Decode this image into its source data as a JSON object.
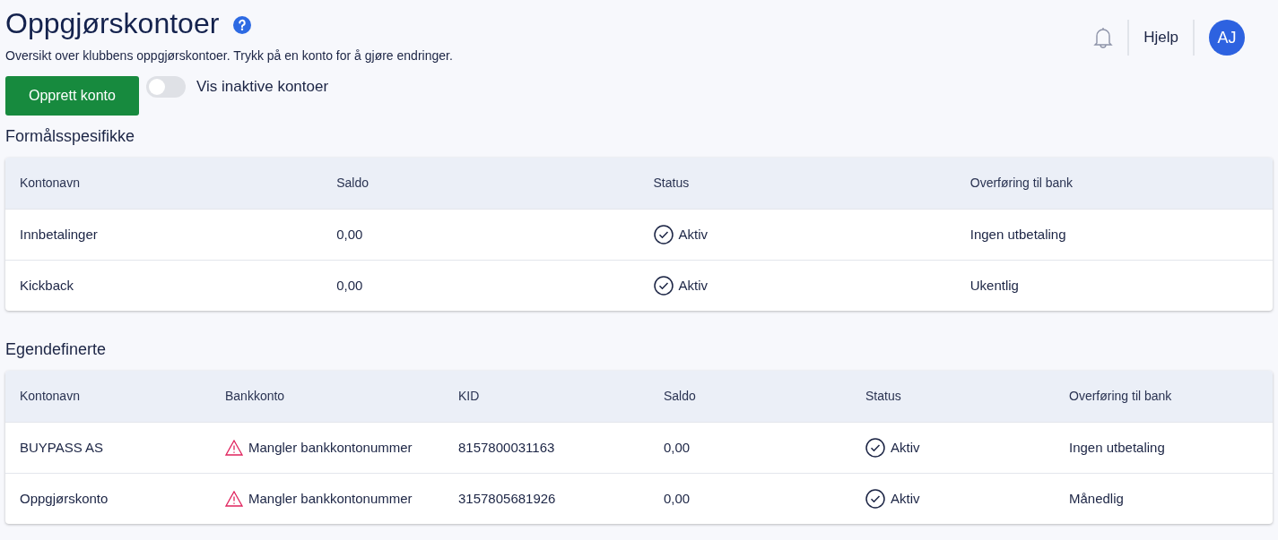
{
  "header": {
    "title": "Oppgjørskontoer",
    "subtitle": "Oversikt over klubbens oppgjørskontoer. Trykk på en konto for å gjøre endringer.",
    "help_link": "Hjelp",
    "avatar": "AJ"
  },
  "actions": {
    "create_button": "Opprett konto",
    "inactive_toggle": {
      "label": "Vis inaktive kontoer",
      "on": false
    }
  },
  "sections": [
    {
      "title": "Formålsspesifikke",
      "columns": [
        "Kontonavn",
        "Saldo",
        "Status",
        "Overføring til bank"
      ],
      "rows": [
        [
          {
            "kind": "text",
            "text": "Innbetalinger"
          },
          {
            "kind": "text",
            "text": "0,00"
          },
          {
            "kind": "status",
            "text": "Aktiv"
          },
          {
            "kind": "text",
            "text": "Ingen utbetaling"
          }
        ],
        [
          {
            "kind": "text",
            "text": "Kickback"
          },
          {
            "kind": "text",
            "text": "0,00"
          },
          {
            "kind": "status",
            "text": "Aktiv"
          },
          {
            "kind": "text",
            "text": "Ukentlig"
          }
        ]
      ]
    },
    {
      "title": "Egendefinerte",
      "columns": [
        "Kontonavn",
        "Bankkonto",
        "KID",
        "Saldo",
        "Status",
        "Overføring til bank"
      ],
      "rows": [
        [
          {
            "kind": "text",
            "text": "BUYPASS AS"
          },
          {
            "kind": "warning",
            "text": "Mangler bankkontonummer"
          },
          {
            "kind": "text",
            "text": "8157800031163"
          },
          {
            "kind": "text",
            "text": "0,00"
          },
          {
            "kind": "status",
            "text": "Aktiv"
          },
          {
            "kind": "text",
            "text": "Ingen utbetaling"
          }
        ],
        [
          {
            "kind": "text",
            "text": "Oppgjørskonto"
          },
          {
            "kind": "warning",
            "text": "Mangler bankkontonummer"
          },
          {
            "kind": "text",
            "text": "3157805681926"
          },
          {
            "kind": "text",
            "text": "0,00"
          },
          {
            "kind": "status",
            "text": "Aktiv"
          },
          {
            "kind": "text",
            "text": "Månedlig"
          }
        ]
      ]
    }
  ]
}
